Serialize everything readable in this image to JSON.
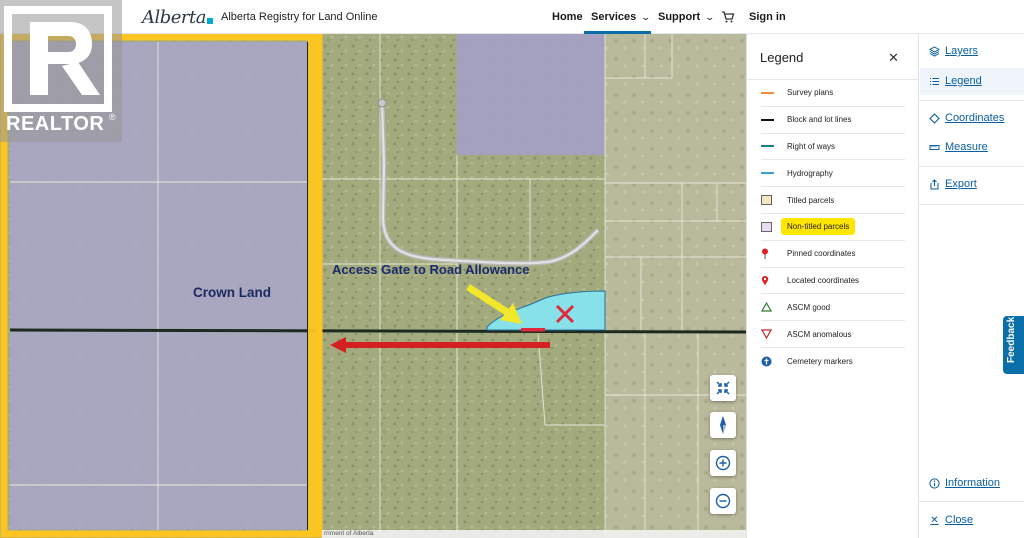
{
  "header": {
    "brand": "Alberta",
    "site_title": "Alberta Registry for Land Online",
    "nav": [
      "Home",
      "Services",
      "Support"
    ],
    "sign_in": "Sign in"
  },
  "map": {
    "attribution": "rnment of Alberta",
    "annotations": {
      "crown_land": "Crown Land",
      "access_gate": "Access Gate to Road Allowance"
    },
    "colors": {
      "outline": "#fcc521",
      "arrow_red": "#d42020",
      "arrow_yellow": "#f2e72a",
      "water": "#86e2e8",
      "non_titled_parcel": "#b6b4e8"
    }
  },
  "watermark": {
    "text": "REALTOR"
  },
  "legend": {
    "title": "Legend",
    "items": [
      {
        "label": "Survey plans",
        "symbol": "line",
        "color": "#f08c3c"
      },
      {
        "label": "Block and lot lines",
        "symbol": "line",
        "color": "#111111"
      },
      {
        "label": "Right of ways",
        "symbol": "line",
        "color": "#1b7c8c"
      },
      {
        "label": "Hydrography",
        "symbol": "line",
        "color": "#3ba0d8"
      },
      {
        "label": "Titled parcels",
        "symbol": "box",
        "color": "#f6e6c0"
      },
      {
        "label": "Non-titled parcels",
        "symbol": "box",
        "color": "#e8dcf2",
        "highlighted": true
      },
      {
        "label": "Pinned coordinates",
        "symbol": "pin-icon",
        "color": "#e02020"
      },
      {
        "label": "Located coordinates",
        "symbol": "location-icon",
        "color": "#e02020"
      },
      {
        "label": "ASCM good",
        "symbol": "triangle-up-icon",
        "color": "#2e7d32"
      },
      {
        "label": "ASCM anomalous",
        "symbol": "triangle-down-icon",
        "color": "#c62828"
      },
      {
        "label": "Cemetery markers",
        "symbol": "cemetery-icon",
        "color": "#1f5fa8"
      }
    ]
  },
  "tools": {
    "layers": "Layers",
    "legend": "Legend",
    "coordinates": "Coordinates",
    "measure": "Measure",
    "export": "Export",
    "information": "Information",
    "close": "Close",
    "feedback": "Feedback"
  }
}
